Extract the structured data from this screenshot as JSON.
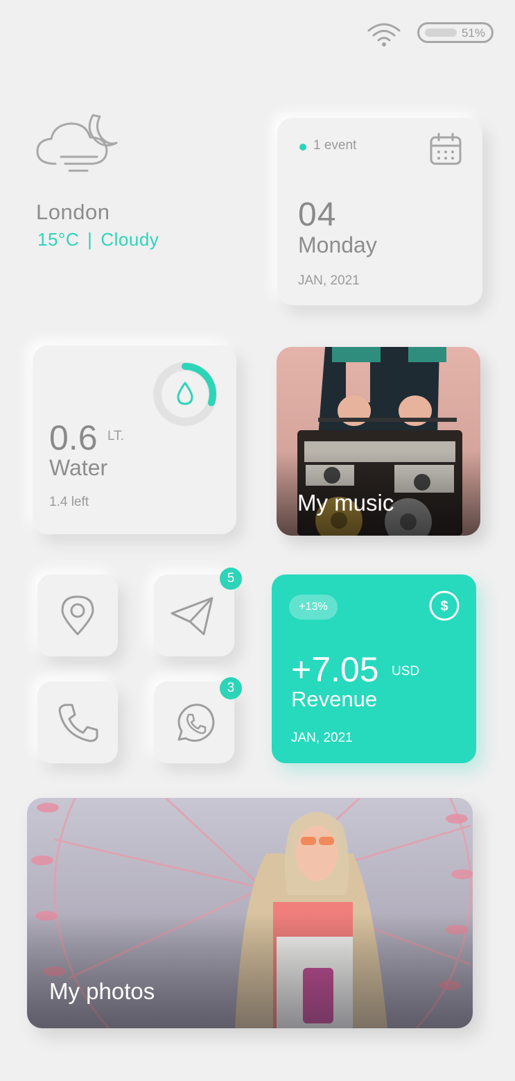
{
  "status_bar": {
    "battery_percent": "51%"
  },
  "weather": {
    "city": "London",
    "temperature": "15°C",
    "separator": "|",
    "condition": "Cloudy",
    "icon": "cloud-moon-icon"
  },
  "calendar": {
    "events": "1 event",
    "day": "04",
    "weekday": "Monday",
    "month_year": "JAN, 2021",
    "icon": "calendar-icon"
  },
  "water": {
    "amount": "0.6",
    "unit": "LT.",
    "label": "Water",
    "remaining": "1.4 left",
    "progress_fraction": 0.3,
    "icon": "water-drop-icon"
  },
  "music": {
    "title": "My music"
  },
  "quick_actions": [
    {
      "icon": "location-pin-icon",
      "badge": ""
    },
    {
      "icon": "send-icon",
      "badge": "5"
    },
    {
      "icon": "phone-icon",
      "badge": ""
    },
    {
      "icon": "whatsapp-icon",
      "badge": "3"
    }
  ],
  "revenue": {
    "change": "+13%",
    "amount": "+7.05",
    "currency": "USD",
    "label": "Revenue",
    "month_year": "JAN, 2021",
    "icon": "dollar-icon"
  },
  "photos": {
    "title": "My photos"
  },
  "colors": {
    "accent": "#27d9bd",
    "background": "#f0f0f0"
  }
}
